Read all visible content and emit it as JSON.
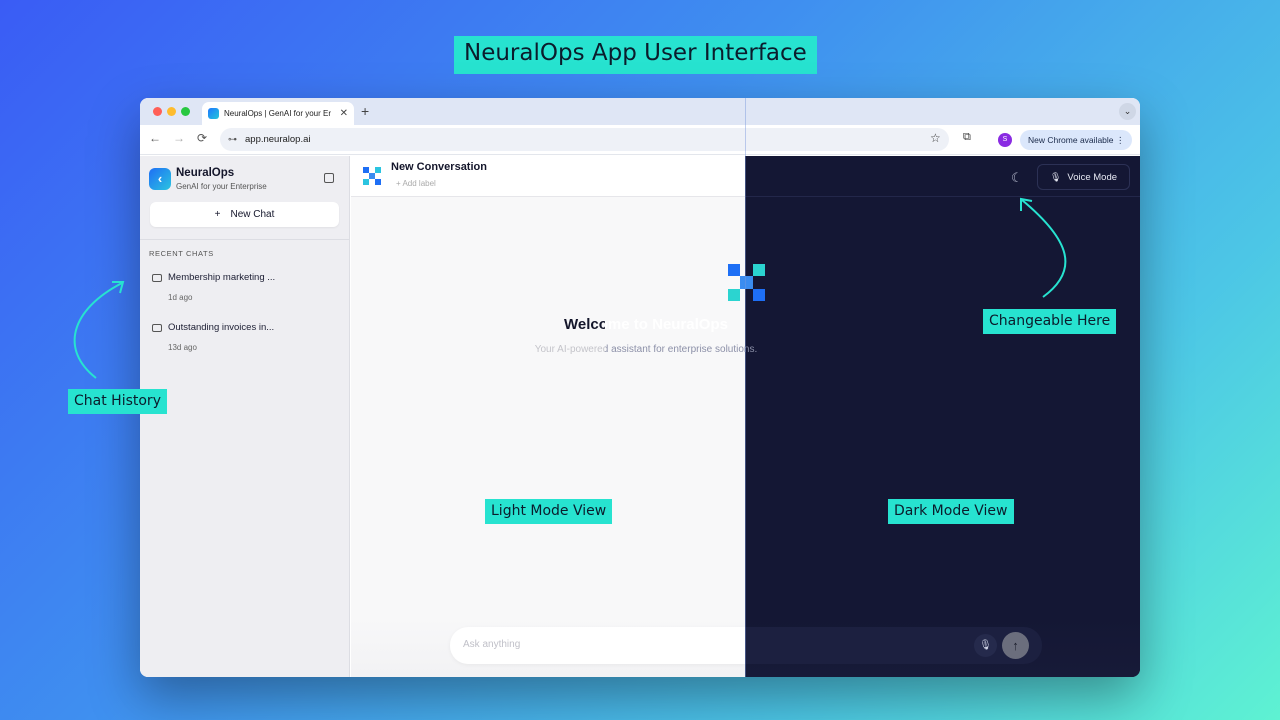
{
  "page_title": "NeuralOps App User Interface",
  "annotations": {
    "chat_history": "Chat History",
    "changeable_here": "Changeable Here",
    "light_mode": "Light Mode View",
    "dark_mode": "Dark Mode View"
  },
  "browser": {
    "tab_title": "NeuralOps | GenAI for your Er",
    "tab_close": "✕",
    "new_tab": "+",
    "dropdown": "⌄",
    "back": "←",
    "forward": "→",
    "reload": "⟳",
    "site_info": "⊶",
    "url": "app.neuralop.ai",
    "star": "☆",
    "extensions": "⧉",
    "profile_initial": "S",
    "update_text": "New Chrome available ⋮"
  },
  "sidebar": {
    "brand_name": "NeuralOps",
    "brand_sub": "GenAI for your Enterprise",
    "new_chat": "New Chat",
    "new_chat_icon": "+",
    "recent_heading": "RECENT CHATS",
    "chats": [
      {
        "title": "Membership marketing ...",
        "time": "1d ago"
      },
      {
        "title": "Outstanding invoices in...",
        "time": "13d ago"
      }
    ]
  },
  "main": {
    "conversation_title": "New Conversation",
    "add_label": "+ Add label",
    "theme_icon": "☾",
    "voice_mode": "Voice Mode",
    "voice_icon": "🎙",
    "welcome_title": "Welcome to NeuralOps",
    "welcome_sub": "Your AI-powered assistant for enterprise solutions.",
    "composer_placeholder": "Ask anything",
    "mic_icon": "🎙",
    "send_icon": "↑"
  },
  "colors": {
    "accent": "#27e3d0",
    "dark_bg": "#141734",
    "light_bg": "#f8f8f9"
  }
}
